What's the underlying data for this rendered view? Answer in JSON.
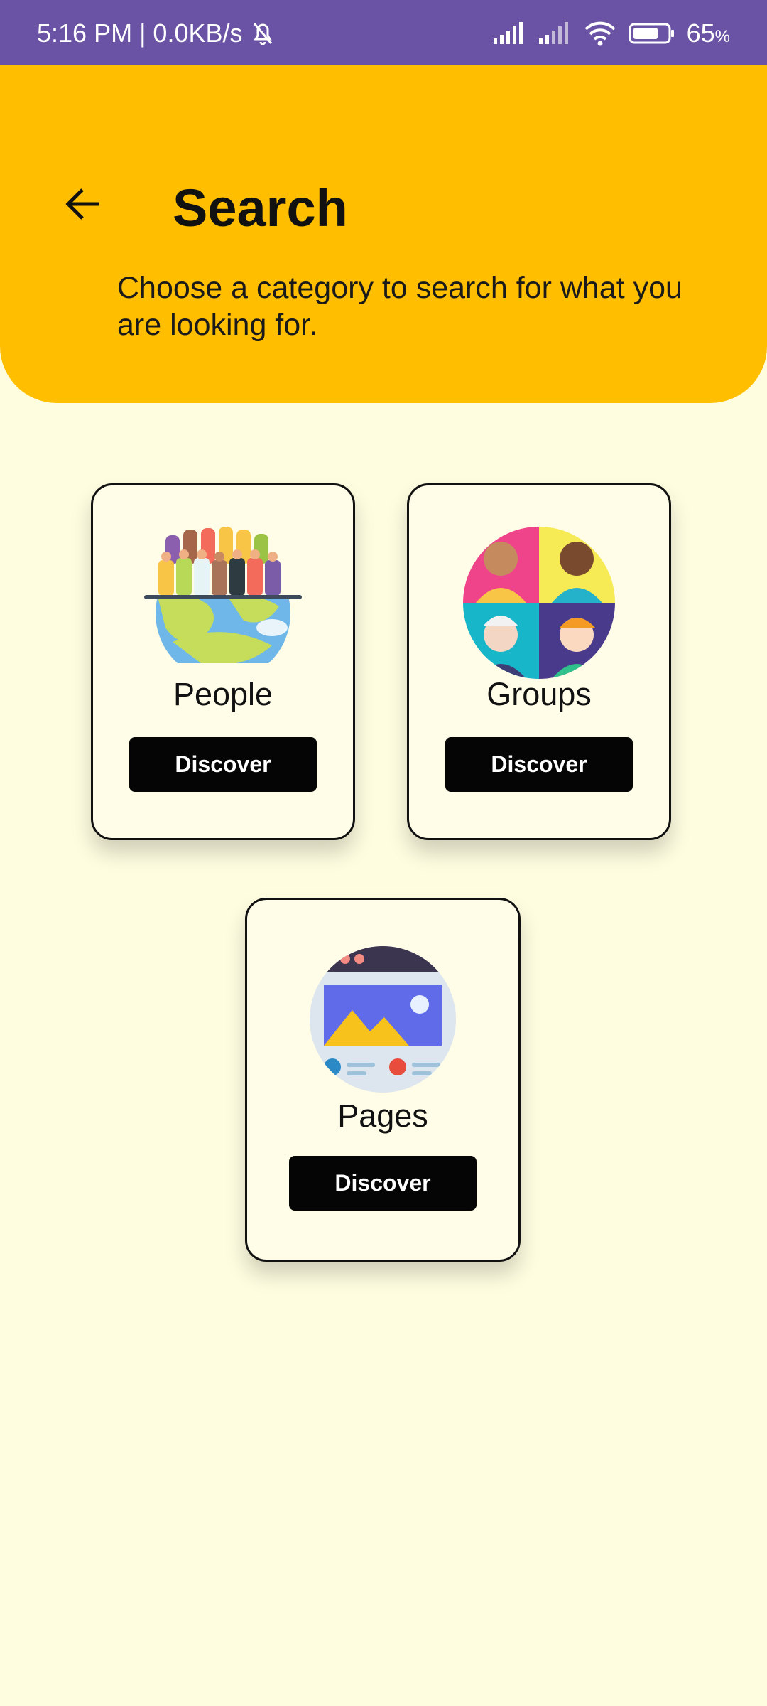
{
  "status_bar": {
    "time_speed": "5:16 PM | 0.0KB/s",
    "battery": "65",
    "battery_unit": "%"
  },
  "header": {
    "title": "Search",
    "subtitle": "Choose a category to search for what you are looking for."
  },
  "categories": [
    {
      "label": "People",
      "button": "Discover",
      "icon": "people-globe-icon"
    },
    {
      "label": "Groups",
      "button": "Discover",
      "icon": "groups-avatars-icon"
    },
    {
      "label": "Pages",
      "button": "Discover",
      "icon": "webpage-icon"
    }
  ],
  "colors": {
    "status_bar": "#6A53A4",
    "header": "#FFBF00",
    "background": "#FFFDE0",
    "button": "#050505"
  }
}
